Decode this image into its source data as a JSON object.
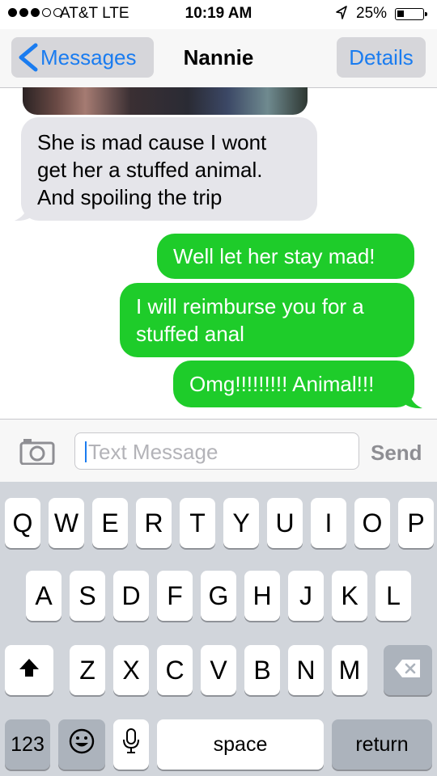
{
  "status_bar": {
    "carrier": "AT&T  LTE",
    "time": "10:19 AM",
    "battery_percent": "25%",
    "battery_level": 0.25,
    "signal_bars_filled": 3,
    "signal_bars_total": 5
  },
  "nav": {
    "back_label": "Messages",
    "title": "Nannie",
    "details_label": "Details"
  },
  "messages": [
    {
      "direction": "received",
      "text": "She is mad cause I wont get her a stuffed animal. And spoiling the trip"
    },
    {
      "direction": "sent",
      "text": "Well let her stay mad!"
    },
    {
      "direction": "sent",
      "text": "I will reimburse you for a stuffed anal"
    },
    {
      "direction": "sent",
      "text": "Omg!!!!!!!!! Animal!!!"
    }
  ],
  "input": {
    "placeholder": "Text Message",
    "send_label": "Send"
  },
  "keyboard": {
    "row1": [
      "Q",
      "W",
      "E",
      "R",
      "T",
      "Y",
      "U",
      "I",
      "O",
      "P"
    ],
    "row2": [
      "A",
      "S",
      "D",
      "F",
      "G",
      "H",
      "J",
      "K",
      "L"
    ],
    "row3": [
      "Z",
      "X",
      "C",
      "V",
      "B",
      "N",
      "M"
    ],
    "numbers_label": "123",
    "space_label": "space",
    "return_label": "return"
  },
  "colors": {
    "sent_bubble": "#1ecc2a",
    "received_bubble": "#e5e5ea",
    "accent": "#1a7cf0"
  },
  "icons": [
    "location-arrow-icon",
    "battery-icon",
    "back-chevron-icon",
    "camera-icon",
    "shift-icon",
    "backspace-icon",
    "emoji-icon",
    "microphone-icon"
  ]
}
